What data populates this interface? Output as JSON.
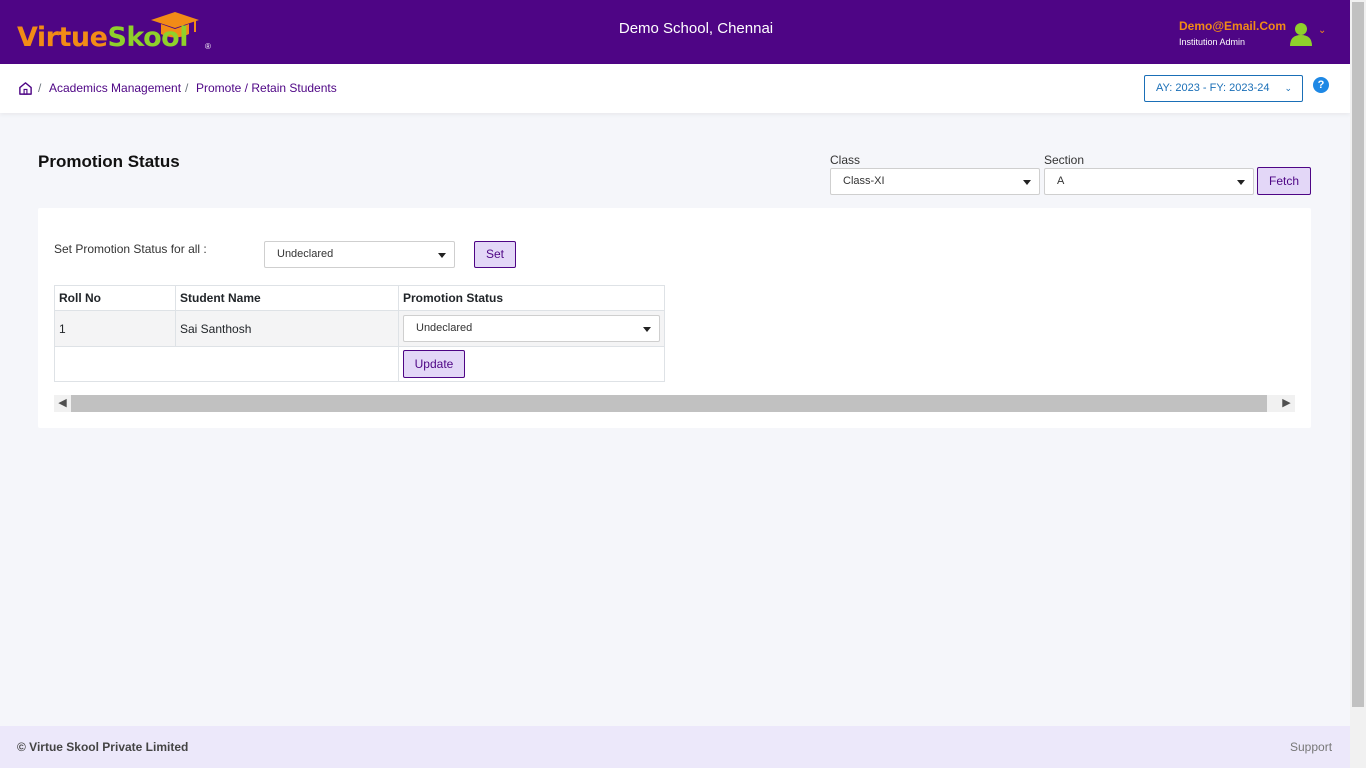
{
  "header": {
    "logo": {
      "part1": "Virtue",
      "part2": "Skool",
      "reg": "®"
    },
    "school_name": "Demo School, Chennai",
    "user_email": "Demo@Email.Com",
    "user_role": "Institution Admin",
    "chevron": "⌄"
  },
  "breadcrumb": {
    "separator": "/",
    "items": [
      "Academics Management",
      "Promote / Retain Students"
    ]
  },
  "academic_year": {
    "label": "AY: 2023 - FY: 2023-24"
  },
  "help": {
    "label": "?"
  },
  "page": {
    "title": "Promotion Status",
    "class_label": "Class",
    "class_value": "Class-XI",
    "section_label": "Section",
    "section_value": "A",
    "fetch_label": "Fetch"
  },
  "bulk": {
    "label": "Set Promotion Status for all :",
    "value": "Undeclared",
    "set_label": "Set"
  },
  "table": {
    "columns": [
      "Roll No",
      "Student Name",
      "Promotion Status"
    ],
    "rows": [
      {
        "roll_no": "1",
        "student_name": "Sai Santhosh",
        "status": "Undeclared"
      }
    ],
    "update_label": "Update"
  },
  "footer": {
    "copyright": "© Virtue Skool Private Limited",
    "support": "Support"
  },
  "colors": {
    "brand_purple": "#4e0585",
    "brand_orange": "#f28b16",
    "brand_green": "#8fd12b",
    "link_blue": "#1a6fb7"
  }
}
